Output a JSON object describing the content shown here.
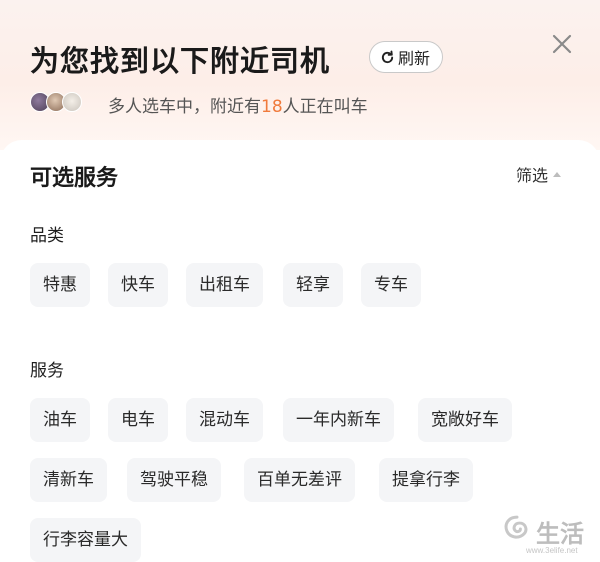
{
  "header": {
    "title": "为您找到以下附近司机",
    "refresh_label": "刷新",
    "status_prefix": "多人选车中，附近有",
    "status_count": "18",
    "status_suffix": "人正在叫车"
  },
  "panel": {
    "section_title": "可选服务",
    "filter_label": "筛选"
  },
  "groups": [
    {
      "label": "品类",
      "chips": [
        "特惠",
        "快车",
        "出租车",
        "轻享",
        "专车"
      ]
    },
    {
      "label": "服务",
      "chips": [
        "油车",
        "电车",
        "混动车",
        "一年内新车",
        "宽敞好车",
        "清新车",
        "驾驶平稳",
        "百单无差评",
        "提拿行李",
        "行李容量大"
      ]
    }
  ],
  "watermark": {
    "text": "生活",
    "url": "www.3elife.net"
  },
  "colors": {
    "accent": "#f07a3c",
    "chip_bg": "#f4f5f7",
    "header_bg": "#fdeee8"
  },
  "icons": [
    "refresh-icon",
    "close-icon",
    "caret-up-icon",
    "avatar"
  ]
}
